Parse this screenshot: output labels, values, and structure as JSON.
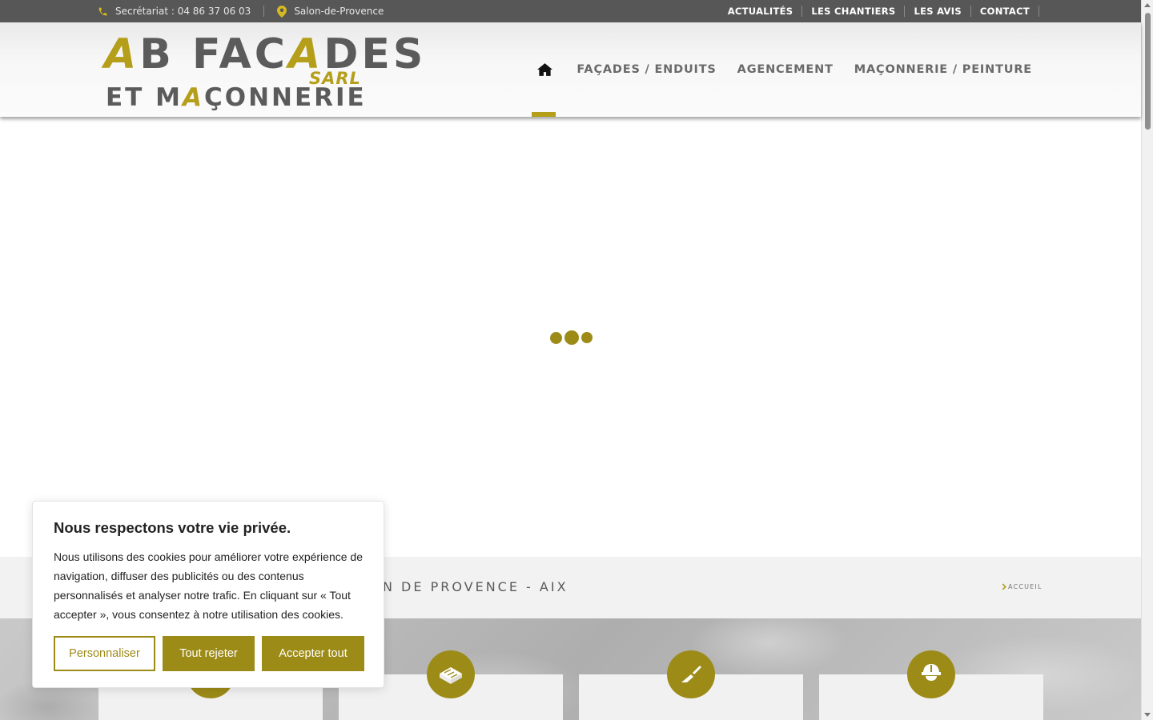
{
  "colors": {
    "accent": "#9d8b17",
    "gold": "#b59e1a",
    "topbar": "#575757"
  },
  "topbar": {
    "phone_icon": "phone-icon",
    "phone_text": "Secrétariat : 04 86 37 06 03",
    "location_icon": "map-pin-icon",
    "location_text": "Salon-de-Provence",
    "links": [
      "ACTUALITÉS",
      "LES CHANTIERS",
      "LES AVIS",
      "CONTACT"
    ]
  },
  "logo": {
    "line1_a1": "A",
    "line1_b": "B FAC",
    "line1_a2": "A",
    "line1_des": "DES",
    "sarl": "SARL",
    "line2_a": "ET M",
    "line2_gold": "A",
    "line2_b": "ÇONNERIE"
  },
  "nav": {
    "home_icon": "home-icon",
    "items": [
      "FAÇADES / ENDUITS",
      "AGENCEMENT",
      "MAÇONNERIE / PEINTURE"
    ]
  },
  "titlebar": {
    "title_visible": "N DE PROVENCE - AIX",
    "breadcrumb": "ACCUEIL"
  },
  "services": {
    "icons": [
      "house-icon",
      "brick-icon",
      "trowel-icon",
      "hard-hat-icon"
    ]
  },
  "cookie": {
    "heading": "Nous respectons votre vie privée.",
    "body": "Nous utilisons des cookies pour améliorer votre expérience de navigation, diffuser des publicités ou des contenus personnalisés et analyser notre trafic. En cliquant sur « Tout accepter », vous consentez à notre utilisation des cookies.",
    "customize": "Personnaliser",
    "reject": "Tout rejeter",
    "accept": "Accepter tout"
  }
}
